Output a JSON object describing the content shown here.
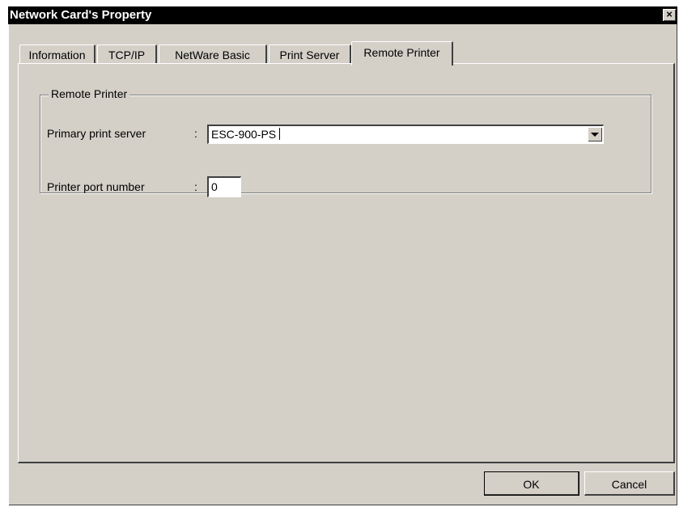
{
  "window": {
    "title": "Network Card's Property",
    "close_symbol": "×"
  },
  "tabs": [
    {
      "label": "Information",
      "active": false
    },
    {
      "label": "TCP/IP",
      "active": false
    },
    {
      "label": "NetWare Basic",
      "active": false
    },
    {
      "label": "Print Server",
      "active": false
    },
    {
      "label": "Remote Printer",
      "active": true
    }
  ],
  "group": {
    "title": "Remote Printer",
    "primary_print_server": {
      "label": "Primary print server",
      "colon": ":",
      "value": "ESC-900-PS"
    },
    "printer_port_number": {
      "label": "Printer port number",
      "colon": ":",
      "value": "0"
    }
  },
  "buttons": {
    "ok": "OK",
    "cancel": "Cancel"
  },
  "icons": {
    "close": "close-icon",
    "dropdown": "chevron-down-icon"
  },
  "colors": {
    "face": "#d4d0c8",
    "titlebar": "#000000",
    "title_text": "#ffffff"
  }
}
